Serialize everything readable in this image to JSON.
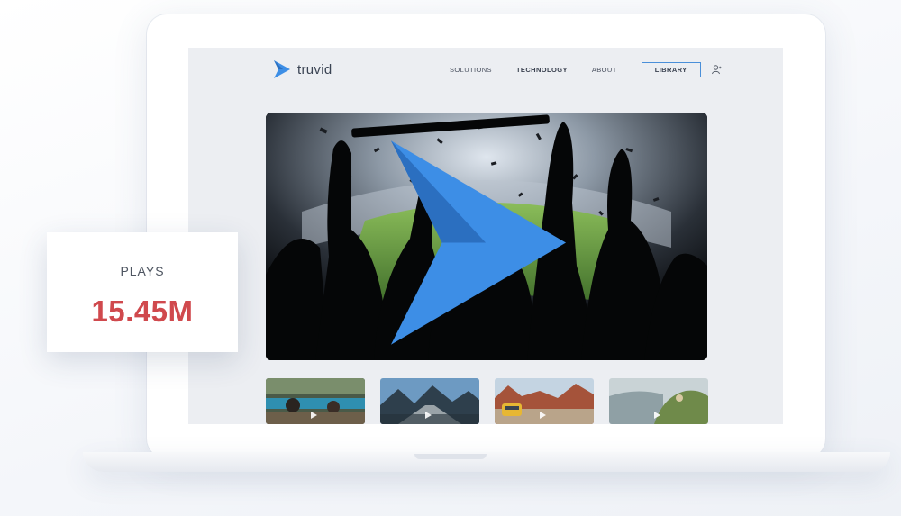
{
  "brand": {
    "name": "truvid",
    "accent_color": "#3d8ee6"
  },
  "nav": {
    "items": [
      {
        "label": "SOLUTIONS"
      },
      {
        "label": "TECHNOLOGY"
      },
      {
        "label": "ABOUT"
      }
    ],
    "library_label": "LIBRARY",
    "user_icon": "user-icon"
  },
  "hero": {
    "icon": "truvid-chevron-icon"
  },
  "thumbnails": [
    {
      "icon": "play-icon"
    },
    {
      "icon": "play-icon"
    },
    {
      "icon": "play-icon"
    },
    {
      "icon": "play-icon"
    }
  ],
  "stat_card": {
    "label": "PLAYS",
    "value": "15.45M",
    "value_color": "#d0494d"
  }
}
